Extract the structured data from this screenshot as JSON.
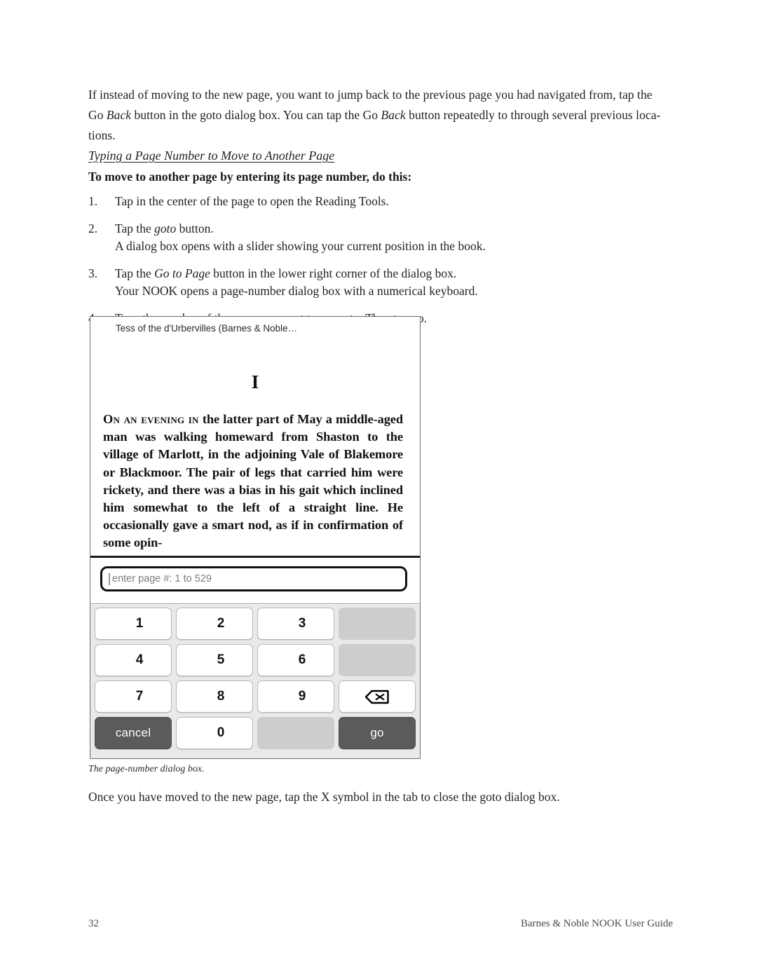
{
  "document": {
    "intro_paragraph": "If instead of moving to the new page, you want to jump back to the previous page you had navigated from, tap the Go Back button in the goto dialog box. You can tap the Go Back button repeatedly to through several previous loca-tions.",
    "sub_heading": "Typing a Page Number to Move to Another Page",
    "bold_lead": "To move to another page by entering its page number, do this:",
    "steps": [
      {
        "number": "1.",
        "line1": "Tap in the center of the page to open the Reading Tools.",
        "line2": ""
      },
      {
        "number": "2.",
        "line1": "Tap the goto button.",
        "line2": "A dialog box opens with a slider showing your current position in the book."
      },
      {
        "number": "3.",
        "line1": "Tap the Go to Page button in the lower right corner of the dialog box.",
        "line2": "Your NOOK opens a page-number dialog box with a numerical keyboard."
      },
      {
        "number": "4.",
        "line1": "Type the number of the page you want to move to. Then tap go.",
        "line2": ""
      }
    ],
    "figure_caption": "The page-number dialog box.",
    "closing_paragraph": "Once you have moved to the new page, tap the X symbol in the tab to close the goto dialog box."
  },
  "screenshot": {
    "title_tab": "Tess of the d'Urbervilles (Barnes & Noble…",
    "chapter_number": "I",
    "book_text": "ON AN EVENING IN the latter part of May a middle-aged man was walking homeward from Shaston to the village of Marlott, in the adjoining Vale of Blakemore or Blackmoor. The pair of legs that carried him were rickety, and there was a bias in his gait which inclined him somewhat to the left of a straight line. He occasionally gave a smart nod, as if in confirmation of some opin-",
    "input": {
      "placeholder": "enter page #: 1 to 529",
      "value": ""
    },
    "keypad": {
      "rows": [
        [
          {
            "label": "1",
            "kind": "num",
            "name": "key-1"
          },
          {
            "label": "2",
            "kind": "num",
            "name": "key-2"
          },
          {
            "label": "3",
            "kind": "num",
            "name": "key-3"
          },
          {
            "label": "",
            "kind": "blank",
            "name": "key-blank-1"
          }
        ],
        [
          {
            "label": "4",
            "kind": "num",
            "name": "key-4"
          },
          {
            "label": "5",
            "kind": "num",
            "name": "key-5"
          },
          {
            "label": "6",
            "kind": "num",
            "name": "key-6"
          },
          {
            "label": "",
            "kind": "blank",
            "name": "key-blank-2"
          }
        ],
        [
          {
            "label": "7",
            "kind": "num",
            "name": "key-7"
          },
          {
            "label": "8",
            "kind": "num",
            "name": "key-8"
          },
          {
            "label": "9",
            "kind": "num",
            "name": "key-9"
          },
          {
            "label": "",
            "kind": "backspace",
            "name": "key-backspace",
            "icon": "backspace-icon"
          }
        ],
        [
          {
            "label": "cancel",
            "kind": "dark",
            "name": "key-cancel"
          },
          {
            "label": "0",
            "kind": "num",
            "name": "key-0"
          },
          {
            "label": "",
            "kind": "blank",
            "name": "key-blank-3"
          },
          {
            "label": "go",
            "kind": "dark",
            "name": "key-go"
          }
        ]
      ]
    },
    "colors": {
      "keypad_background": "#e9e9e9",
      "key_white": "#ffffff",
      "key_blank": "#cdcdcd",
      "key_dark": "#5b5b5b",
      "key_dark_text": "#ffffff"
    }
  },
  "footer": {
    "page_number": "32",
    "guide_title": "Barnes & Noble NOOK User Guide"
  }
}
